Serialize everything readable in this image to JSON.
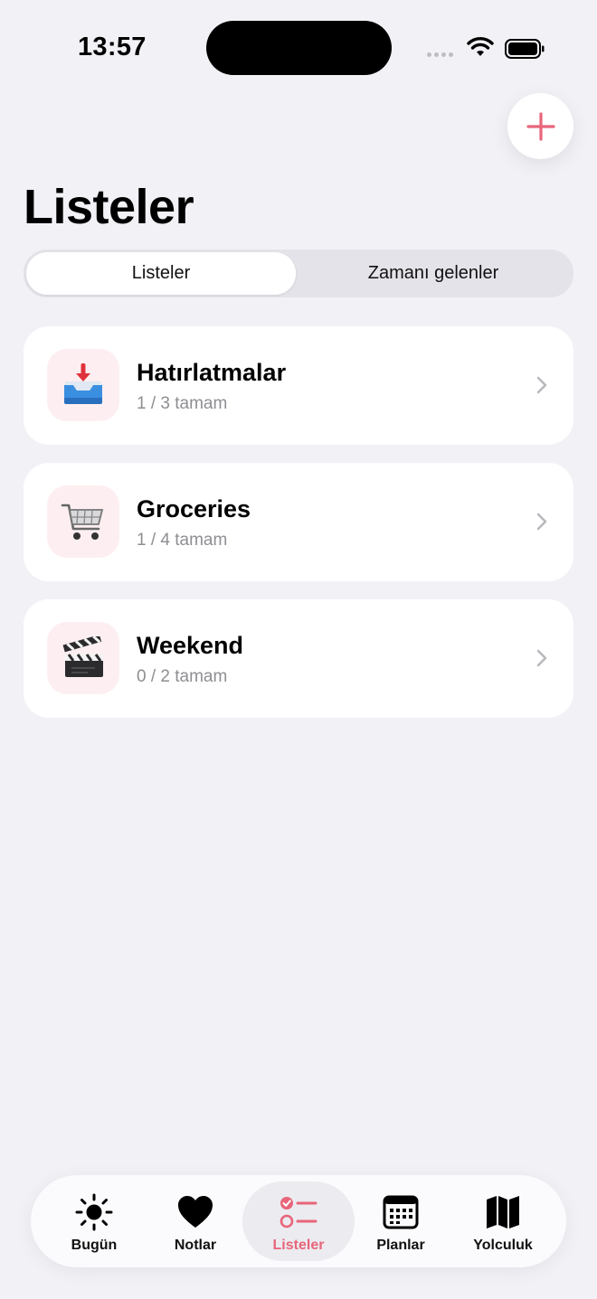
{
  "status_bar": {
    "time": "13:57"
  },
  "header": {
    "title": "Listeler"
  },
  "segmented": {
    "active_label": "Listeler",
    "inactive_label": "Zamanı gelenler"
  },
  "lists": [
    {
      "title": "Hatırlatmalar",
      "subtitle": "1 / 3 tamam",
      "icon": "inbox-tray-icon"
    },
    {
      "title": "Groceries",
      "subtitle": "1 / 4 tamam",
      "icon": "shopping-cart-icon"
    },
    {
      "title": "Weekend",
      "subtitle": "0 / 2 tamam",
      "icon": "clapperboard-icon"
    }
  ],
  "tab_bar": {
    "items": [
      {
        "label": "Bugün",
        "icon": "sun-icon"
      },
      {
        "label": "Notlar",
        "icon": "heart-icon"
      },
      {
        "label": "Listeler",
        "icon": "checklist-icon",
        "active": true
      },
      {
        "label": "Planlar",
        "icon": "calendar-icon"
      },
      {
        "label": "Yolculuk",
        "icon": "map-icon"
      }
    ]
  },
  "colors": {
    "accent": "#e8657a",
    "background": "#f2f1f6",
    "icon_tile": "#fdeff1"
  }
}
